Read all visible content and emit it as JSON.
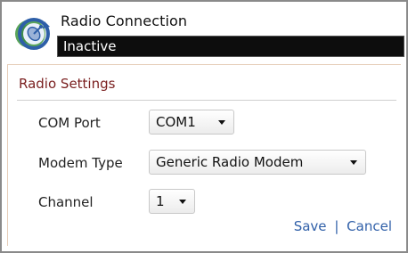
{
  "app": {
    "title": "Radio Connection",
    "icon": "radio-connection-icon"
  },
  "status": {
    "text": "Inactive"
  },
  "panel": {
    "title": "Radio Settings"
  },
  "fields": {
    "com_port": {
      "label": "COM Port",
      "value": "COM1"
    },
    "modem_type": {
      "label": "Modem Type",
      "value": "Generic Radio Modem"
    },
    "channel": {
      "label": "Channel",
      "value": "1"
    }
  },
  "actions": {
    "save_label": "Save",
    "separator": "|",
    "cancel_label": "Cancel"
  },
  "colors": {
    "panel_title": "#7a1f1f",
    "link": "#2f5fa8",
    "status_bar": "#0d0d0d"
  }
}
